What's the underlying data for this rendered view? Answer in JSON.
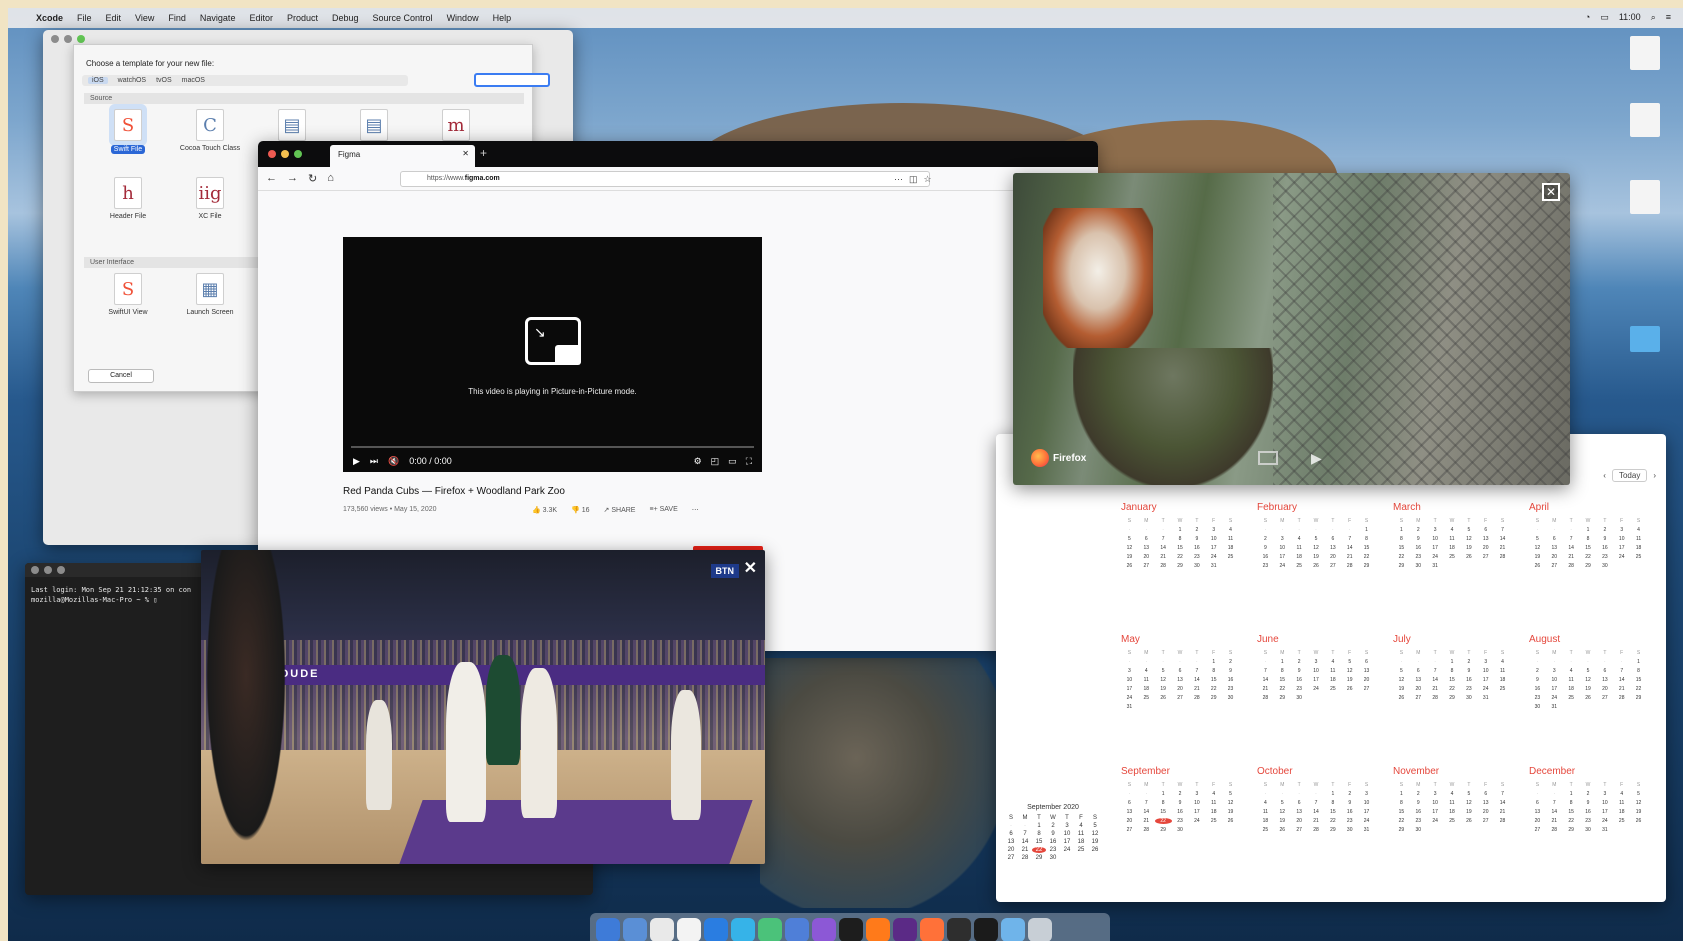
{
  "menubar": {
    "app_name": "Xcode",
    "menus": [
      "File",
      "Edit",
      "View",
      "Find",
      "Navigate",
      "Editor",
      "Product",
      "Debug",
      "Source Control",
      "Window",
      "Help"
    ],
    "clock": "11:00"
  },
  "xcode": {
    "prompt": "Choose a template for your new file:",
    "platforms": [
      "iOS",
      "watchOS",
      "tvOS",
      "macOS"
    ],
    "section_source": "Source",
    "section_ui": "User Interface",
    "templates_source": [
      {
        "label": "Swift File",
        "glyph": "S",
        "selected": true
      },
      {
        "label": "Cocoa Touch Class",
        "glyph": "C"
      },
      {
        "label": "",
        "glyph": "▤"
      },
      {
        "label": "",
        "glyph": "▤"
      },
      {
        "label": "",
        "glyph": "m"
      },
      {
        "label": "Header File",
        "glyph": "h"
      },
      {
        "label": "XC File",
        "glyph": "iig"
      }
    ],
    "templates_ui": [
      {
        "label": "SwiftUI View",
        "glyph": "S"
      },
      {
        "label": "Launch Screen",
        "glyph": "▦"
      }
    ],
    "cancel_label": "Cancel"
  },
  "firefox": {
    "tab_title": "Figma",
    "url_prefix": "https://www.",
    "url_domain": "figma.com",
    "pip_message": "This video is playing in Picture-in-Picture mode.",
    "time": "0:00 / 0:00",
    "video_title": "Red Panda Cubs — Firefox + Woodland Park Zoo",
    "video_meta": "173,560 views • May 15, 2020",
    "likes": "3.3K",
    "dislikes": "16",
    "share": "SHARE",
    "save": "SAVE"
  },
  "pip_panda": {
    "brand": "Firefox"
  },
  "pip_basketball": {
    "banner": "LOUDE",
    "badge": "BTN"
  },
  "terminal": {
    "lines": [
      "Last login: Mon Sep 21 21:12:35 on con",
      "mozilla@Mozillas-Mac-Pro ~ % ▯"
    ]
  },
  "calendar": {
    "today_label": "Today",
    "mini_month": "September 2020",
    "months": [
      {
        "name": "January",
        "offset": 3,
        "days": 31
      },
      {
        "name": "February",
        "offset": 6,
        "days": 29
      },
      {
        "name": "March",
        "offset": 0,
        "days": 31
      },
      {
        "name": "April",
        "offset": 3,
        "days": 30
      },
      {
        "name": "May",
        "offset": 5,
        "days": 31
      },
      {
        "name": "June",
        "offset": 1,
        "days": 30
      },
      {
        "name": "July",
        "offset": 3,
        "days": 31
      },
      {
        "name": "August",
        "offset": 6,
        "days": 31
      },
      {
        "name": "September",
        "offset": 2,
        "days": 30,
        "today": 22
      },
      {
        "name": "October",
        "offset": 4,
        "days": 31
      },
      {
        "name": "November",
        "offset": 0,
        "days": 30
      },
      {
        "name": "December",
        "offset": 2,
        "days": 31
      }
    ],
    "weekday_initials": [
      "S",
      "M",
      "T",
      "W",
      "T",
      "F",
      "S"
    ]
  },
  "desktop_icons": [
    "",
    "",
    "",
    "",
    ""
  ],
  "colors": {
    "calendar_accent": "#e5473c",
    "selection_blue": "#2b67d6",
    "firefox_dark": "#0c0c0d"
  }
}
